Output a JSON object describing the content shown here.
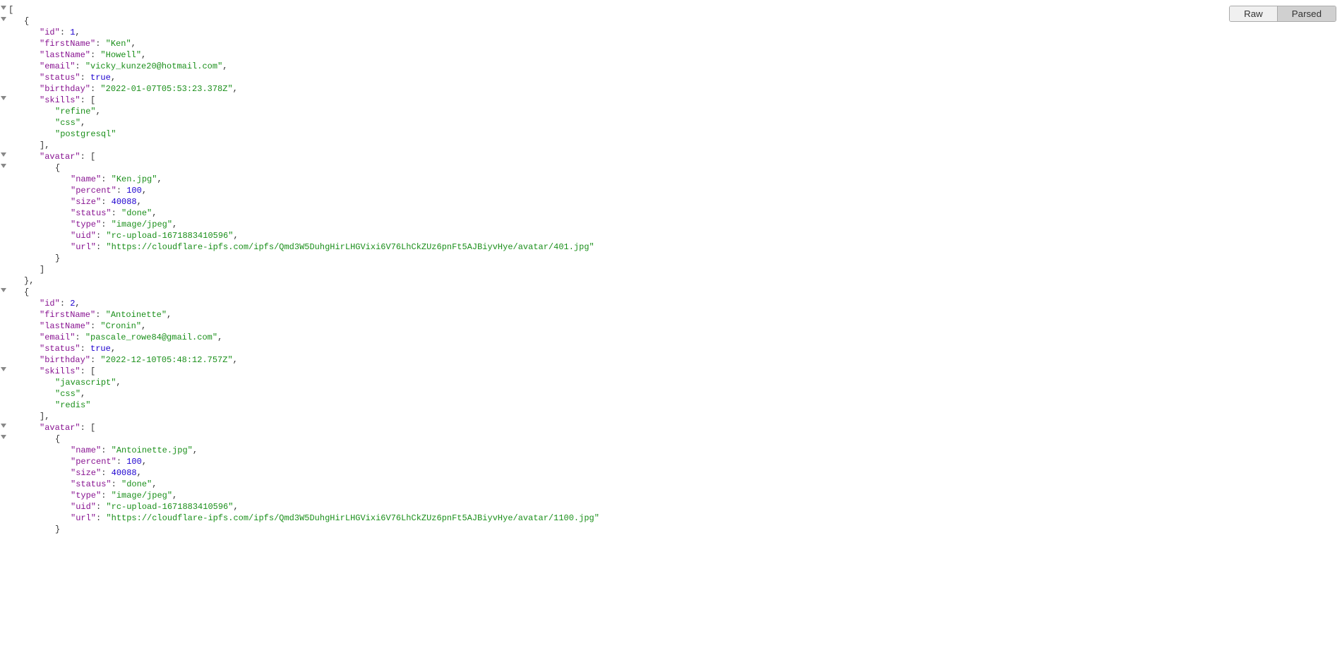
{
  "tabs": {
    "raw": "Raw",
    "parsed": "Parsed",
    "active": "parsed"
  },
  "json": [
    {
      "id": 1,
      "firstName": "Ken",
      "lastName": "Howell",
      "email": "vicky_kunze20@hotmail.com",
      "status": true,
      "birthday": "2022-01-07T05:53:23.378Z",
      "skills": [
        "refine",
        "css",
        "postgresql"
      ],
      "avatar": [
        {
          "name": "Ken.jpg",
          "percent": 100,
          "size": 40088,
          "status": "done",
          "type": "image/jpeg",
          "uid": "rc-upload-1671883410596",
          "url": "https://cloudflare-ipfs.com/ipfs/Qmd3W5DuhgHirLHGVixi6V76LhCkZUz6pnFt5AJBiyvHye/avatar/401.jpg"
        }
      ]
    },
    {
      "id": 2,
      "firstName": "Antoinette",
      "lastName": "Cronin",
      "email": "pascale_rowe84@gmail.com",
      "status": true,
      "birthday": "2022-12-10T05:48:12.757Z",
      "skills": [
        "javascript",
        "css",
        "redis"
      ],
      "avatar": [
        {
          "name": "Antoinette.jpg",
          "percent": 100,
          "size": 40088,
          "status": "done",
          "type": "image/jpeg",
          "uid": "rc-upload-1671883410596",
          "url": "https://cloudflare-ipfs.com/ipfs/Qmd3W5DuhgHirLHGVixi6V76LhCkZUz6pnFt5AJBiyvHye/avatar/1100.jpg"
        }
      ]
    }
  ]
}
